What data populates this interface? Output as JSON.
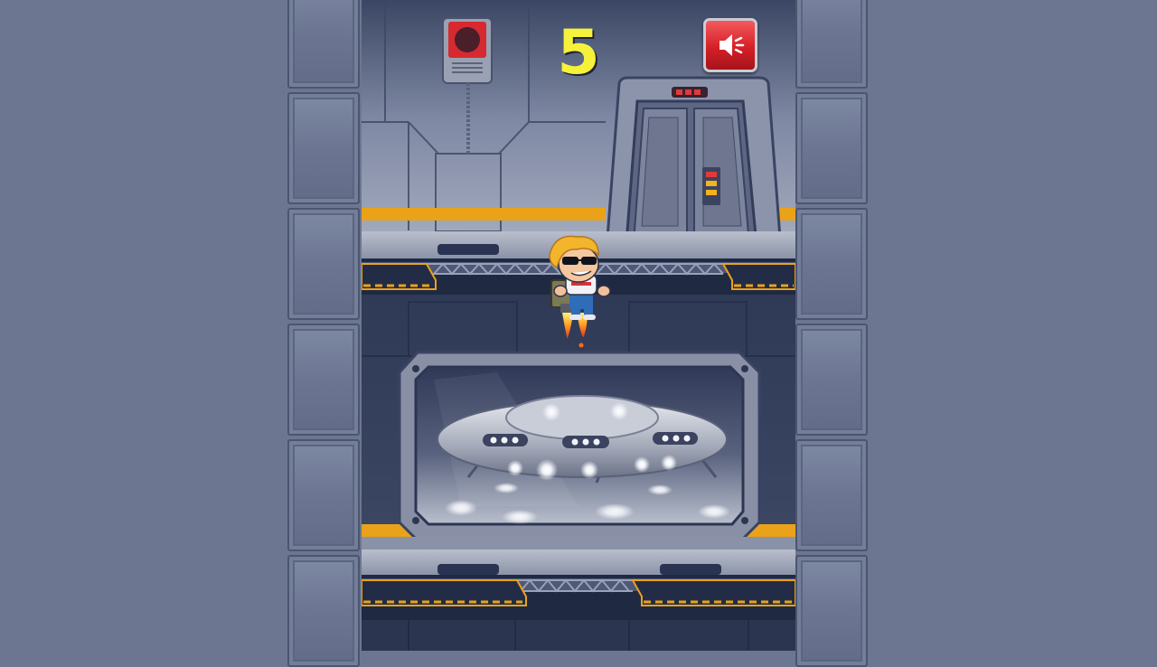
{
  "hud": {
    "score": "5",
    "sound_icon": "speaker-icon"
  },
  "player": {
    "name_icon": "jetpack-hero-sprite"
  },
  "scene": {
    "background": "space-station-corridor",
    "window_view": "ufo-hangar",
    "accent": "#f2a91c",
    "score_color": "#f6f23a",
    "sound_button_color": "#d61f27"
  }
}
